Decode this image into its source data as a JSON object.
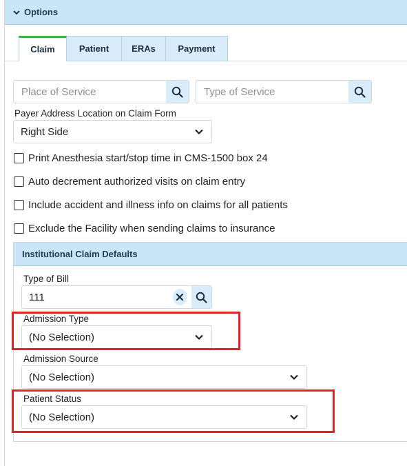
{
  "options": {
    "title": "Options"
  },
  "tabs": [
    {
      "label": "Claim"
    },
    {
      "label": "Patient"
    },
    {
      "label": "ERAs"
    },
    {
      "label": "Payment"
    }
  ],
  "claim": {
    "place_of_service_placeholder": "Place of Service",
    "type_of_service_placeholder": "Type of Service",
    "payer_address_label": "Payer Address Location on Claim Form",
    "payer_address_value": "Right Side",
    "checkboxes": [
      {
        "label": "Print Anesthesia start/stop time in CMS-1500 box 24",
        "checked": false
      },
      {
        "label": "Auto decrement authorized visits on claim entry",
        "checked": false
      },
      {
        "label": "Include accident and illness info on claims for all patients",
        "checked": false
      },
      {
        "label": "Exclude the Facility when sending claims to insurance",
        "checked": false
      }
    ]
  },
  "institutional": {
    "title": "Institutional Claim Defaults",
    "type_of_bill_label": "Type of Bill",
    "type_of_bill_value": "111",
    "admission_type_label": "Admission Type",
    "admission_type_value": "(No Selection)",
    "admission_source_label": "Admission Source",
    "admission_source_value": "(No Selection)",
    "patient_status_label": "Patient Status",
    "patient_status_value": "(No Selection)"
  },
  "colors": {
    "header_bg": "#c9e5f7",
    "tab_active_accent": "#3fb04c",
    "highlight": "#e02424"
  }
}
